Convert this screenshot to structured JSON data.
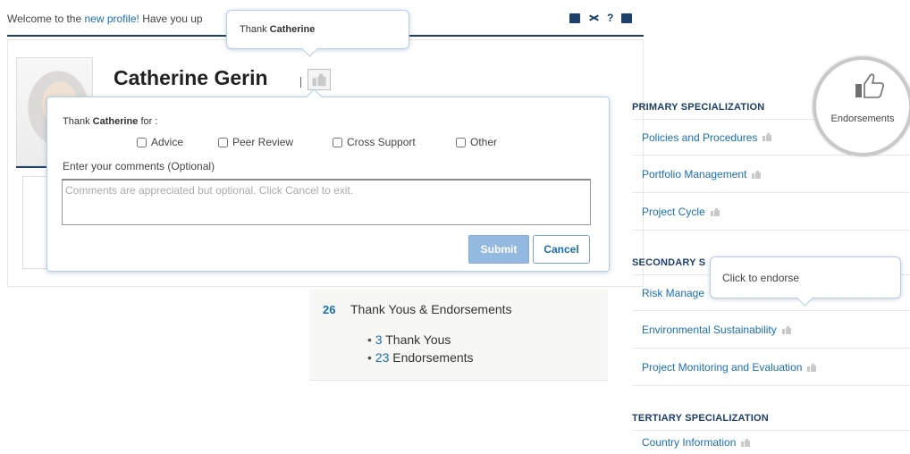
{
  "welcome": {
    "prefix": "Welcome to the ",
    "link": "new profile!",
    "suffix": " Have you up"
  },
  "toolbar": [
    "mailbox-icon",
    "share-icon",
    "help-icon",
    "print-icon"
  ],
  "toolbar_help_glyph": "?",
  "tooltip_thank": {
    "prefix": "Thank ",
    "name": "Catherine"
  },
  "profile": {
    "name": "Catherine Gerin"
  },
  "dialog": {
    "thank_prefix": "Thank ",
    "thank_name": "Catherine",
    "thank_suffix": " for :",
    "options": [
      "Advice",
      "Peer Review",
      "Cross Support",
      "Other"
    ],
    "comments_label": "Enter your comments (Optional)",
    "comments_placeholder": "Comments are appreciated but optional. Click Cancel to exit.",
    "submit": "Submit",
    "cancel": "Cancel"
  },
  "summary": {
    "count": "26",
    "title": "Thank Yous & Endorsements",
    "items": [
      {
        "num": "3",
        "label": " Thank Yous"
      },
      {
        "num": "23",
        "label": " Endorsements"
      }
    ]
  },
  "badge": {
    "label": "Endorsements"
  },
  "tooltip_endorse": "Click to endorse",
  "specializations": {
    "primary": {
      "heading": "PRIMARY SPECIALIZATION",
      "items": [
        "Policies and Procedures",
        "Portfolio Management",
        "Project Cycle"
      ]
    },
    "secondary": {
      "heading": "SECONDARY S",
      "items": [
        "Risk Manage",
        "Environmental Sustainability",
        "Project Monitoring and Evaluation"
      ]
    },
    "tertiary": {
      "heading": "TERTIARY SPECIALIZATION",
      "items": [
        "Country Information"
      ]
    }
  },
  "colors": {
    "accent": "#1a6fb4",
    "navy": "#1d3f6a",
    "submit": "#93b9e0"
  }
}
